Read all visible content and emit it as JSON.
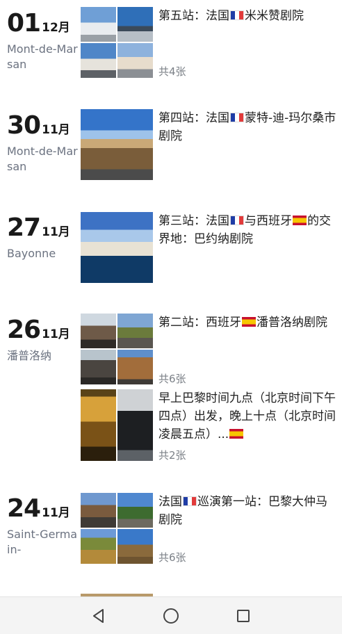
{
  "entries": [
    {
      "day": "01",
      "month": "12月",
      "location": "Mont-de-Marsan",
      "title_parts": [
        "第五站：法国",
        "米米赞剧院"
      ],
      "count": "共4张"
    },
    {
      "day": "30",
      "month": "11月",
      "location": "Mont-de-Marsan",
      "title_parts": [
        "第四站：法国",
        "蒙特-迪-玛尔桑市剧院"
      ],
      "count": ""
    },
    {
      "day": "27",
      "month": "11月",
      "location": "Bayonne",
      "title_parts": [
        "第三站：法国",
        "与西班牙",
        "的交界地：巴约纳剧院"
      ],
      "count": ""
    },
    {
      "day": "26",
      "month": "11月",
      "location": "潘普洛纳",
      "title_parts": [
        "第二站：西班牙",
        "潘普洛纳剧院"
      ],
      "count": "共6张",
      "sub": {
        "title": "早上巴黎时间九点（北京时间下午四点）出发，晚上十点（北京时间凌晨五点）...",
        "count": "共2张"
      }
    },
    {
      "day": "24",
      "month": "11月",
      "location": "Saint-Germain-",
      "title_parts": [
        "法国",
        "巡演第一站：巴黎大仲马剧院"
      ],
      "count": "共6张"
    }
  ],
  "icons": {
    "back": "back-triangle-icon",
    "home": "home-circle-icon",
    "recents": "recents-square-icon"
  },
  "colors": {
    "secondary_text": "#6b7280",
    "navbar_bg": "#f4f4f4"
  }
}
